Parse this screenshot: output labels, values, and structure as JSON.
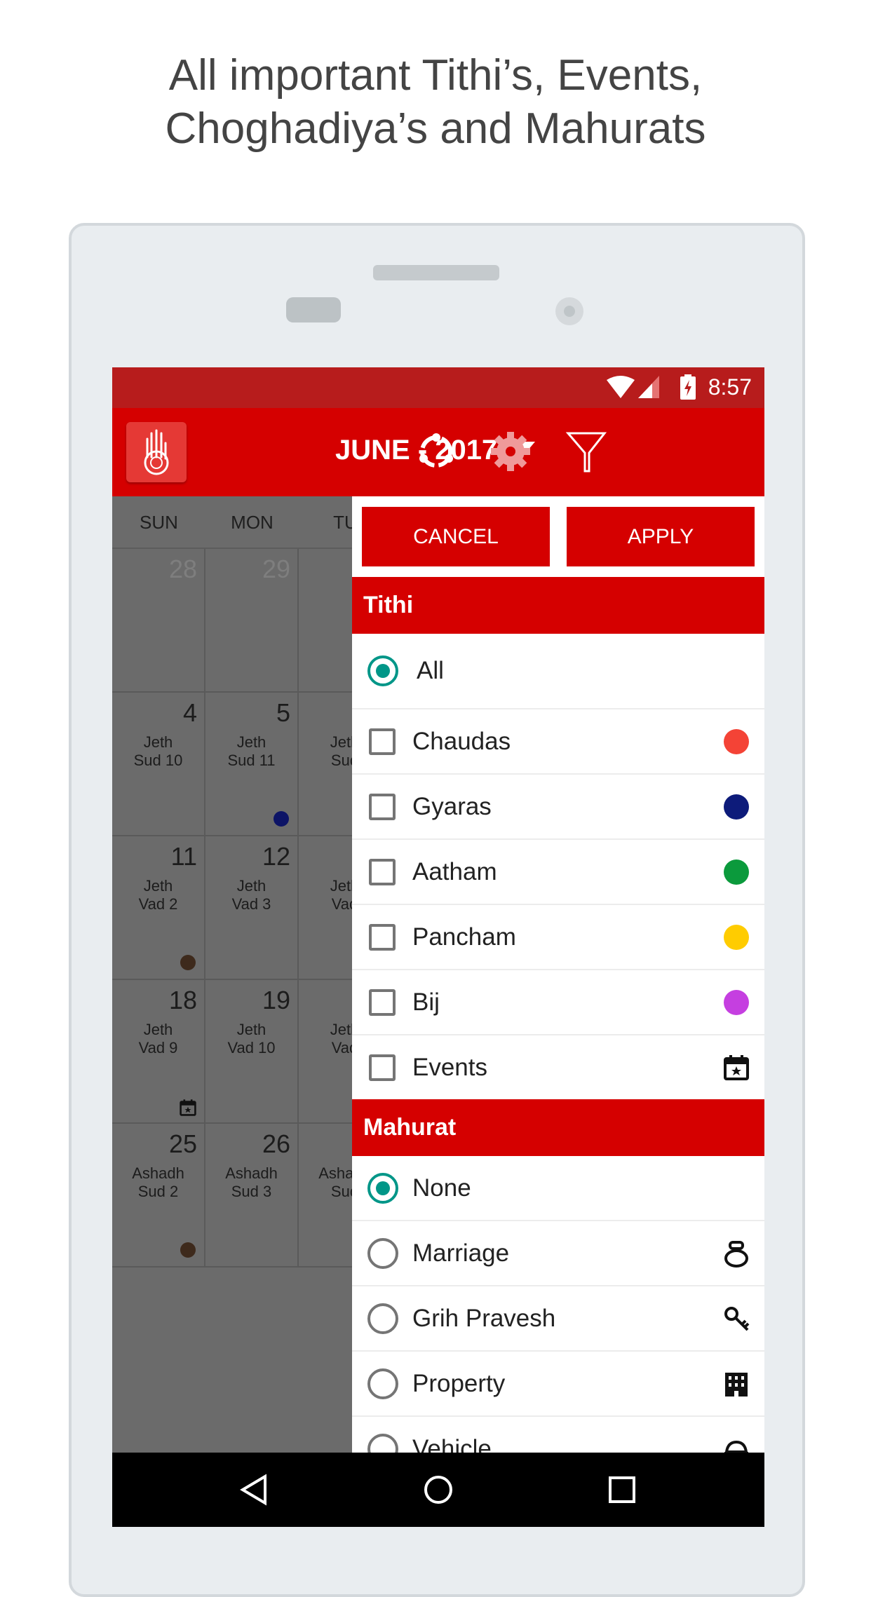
{
  "headline": {
    "line1": "All important Tithi’s, Events,",
    "line2": "Choghadiya’s and Mahurats"
  },
  "status_bar": {
    "time": "8:57",
    "icons": [
      "wifi-icon",
      "signal-icon",
      "battery-charging-icon"
    ]
  },
  "app_bar": {
    "month_label": "JUNE - 2017",
    "icons": [
      "hand-logo-icon",
      "dropdown-arrow-icon",
      "share-icon",
      "gear-icon",
      "filter-icon"
    ]
  },
  "calendar": {
    "weekdays": [
      "SUN",
      "MON",
      "TU"
    ],
    "rows": [
      {
        "cells": [
          {
            "num": "28",
            "dim": true,
            "lines": ""
          },
          {
            "num": "29",
            "dim": true,
            "lines": ""
          },
          {
            "num": "",
            "lines": ""
          }
        ]
      },
      {
        "cells": [
          {
            "num": "4",
            "lines": "Jeth\nSud 10"
          },
          {
            "num": "5",
            "lines": "Jeth\nSud 11",
            "dot": "#0d1466"
          },
          {
            "num": "",
            "lines": "Jeth\nSud"
          }
        ]
      },
      {
        "cells": [
          {
            "num": "11",
            "lines": "Jeth\nVad 2",
            "dot": "#3e2a1c"
          },
          {
            "num": "12",
            "lines": "Jeth\nVad 3"
          },
          {
            "num": "",
            "lines": "Jeth\nVad"
          }
        ]
      },
      {
        "cells": [
          {
            "num": "18",
            "lines": "Jeth\nVad 9",
            "event": true
          },
          {
            "num": "19",
            "lines": "Jeth\nVad 10"
          },
          {
            "num": "",
            "lines": "Jeth\nVad"
          }
        ]
      },
      {
        "cells": [
          {
            "num": "25",
            "lines": "Ashadh\nSud 2",
            "dot": "#3e2a1c"
          },
          {
            "num": "26",
            "lines": "Ashadh\nSud 3"
          },
          {
            "num": "",
            "lines": "Ashadh\nSud"
          }
        ]
      }
    ]
  },
  "filter_panel": {
    "cancel_label": "CANCEL",
    "apply_label": "APPLY",
    "tithi": {
      "title": "Tithi",
      "all_label": "All",
      "all_selected": true,
      "items": [
        {
          "label": "Chaudas",
          "color": "#f44336",
          "checked": false
        },
        {
          "label": "Gyaras",
          "color": "#0d1b7a",
          "checked": false
        },
        {
          "label": "Aatham",
          "color": "#0b9a3c",
          "checked": false
        },
        {
          "label": "Pancham",
          "color": "#ffcc00",
          "checked": false
        },
        {
          "label": "Bij",
          "color": "#c53fe0",
          "checked": false
        },
        {
          "label": "Events",
          "icon": "calendar-star-icon",
          "checked": false
        }
      ]
    },
    "mahurat": {
      "title": "Mahurat",
      "items": [
        {
          "label": "None",
          "selected": true
        },
        {
          "label": "Marriage",
          "icon": "ring-icon",
          "selected": false
        },
        {
          "label": "Grih Pravesh",
          "icon": "key-icon",
          "selected": false
        },
        {
          "label": "Property",
          "icon": "building-icon",
          "selected": false
        },
        {
          "label": "Vehicle",
          "icon": "car-icon",
          "selected": false
        }
      ]
    }
  },
  "colors": {
    "primary": "#d50000",
    "status": "#b71c1c",
    "radio": "#009688"
  },
  "nav_bar": {
    "icons": [
      "back-icon",
      "home-icon",
      "recents-icon"
    ]
  }
}
